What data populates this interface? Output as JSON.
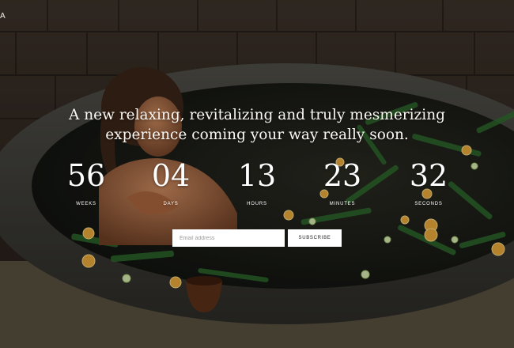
{
  "header": {
    "brand": "A"
  },
  "hero": {
    "headline_line1": "A new relaxing, revitalizing and truly mesmerizing",
    "headline_line2": "experience coming your way really soon."
  },
  "countdown": [
    {
      "value": "56",
      "label": "WEEKS"
    },
    {
      "value": "04",
      "label": "DAYS"
    },
    {
      "value": "13",
      "label": "HOURS"
    },
    {
      "value": "23",
      "label": "MINUTES"
    },
    {
      "value": "32",
      "label": "SECONDS"
    }
  ],
  "subscribe": {
    "email_placeholder": "Email address",
    "email_value": "",
    "button_label": "SUBSCRIBE"
  }
}
